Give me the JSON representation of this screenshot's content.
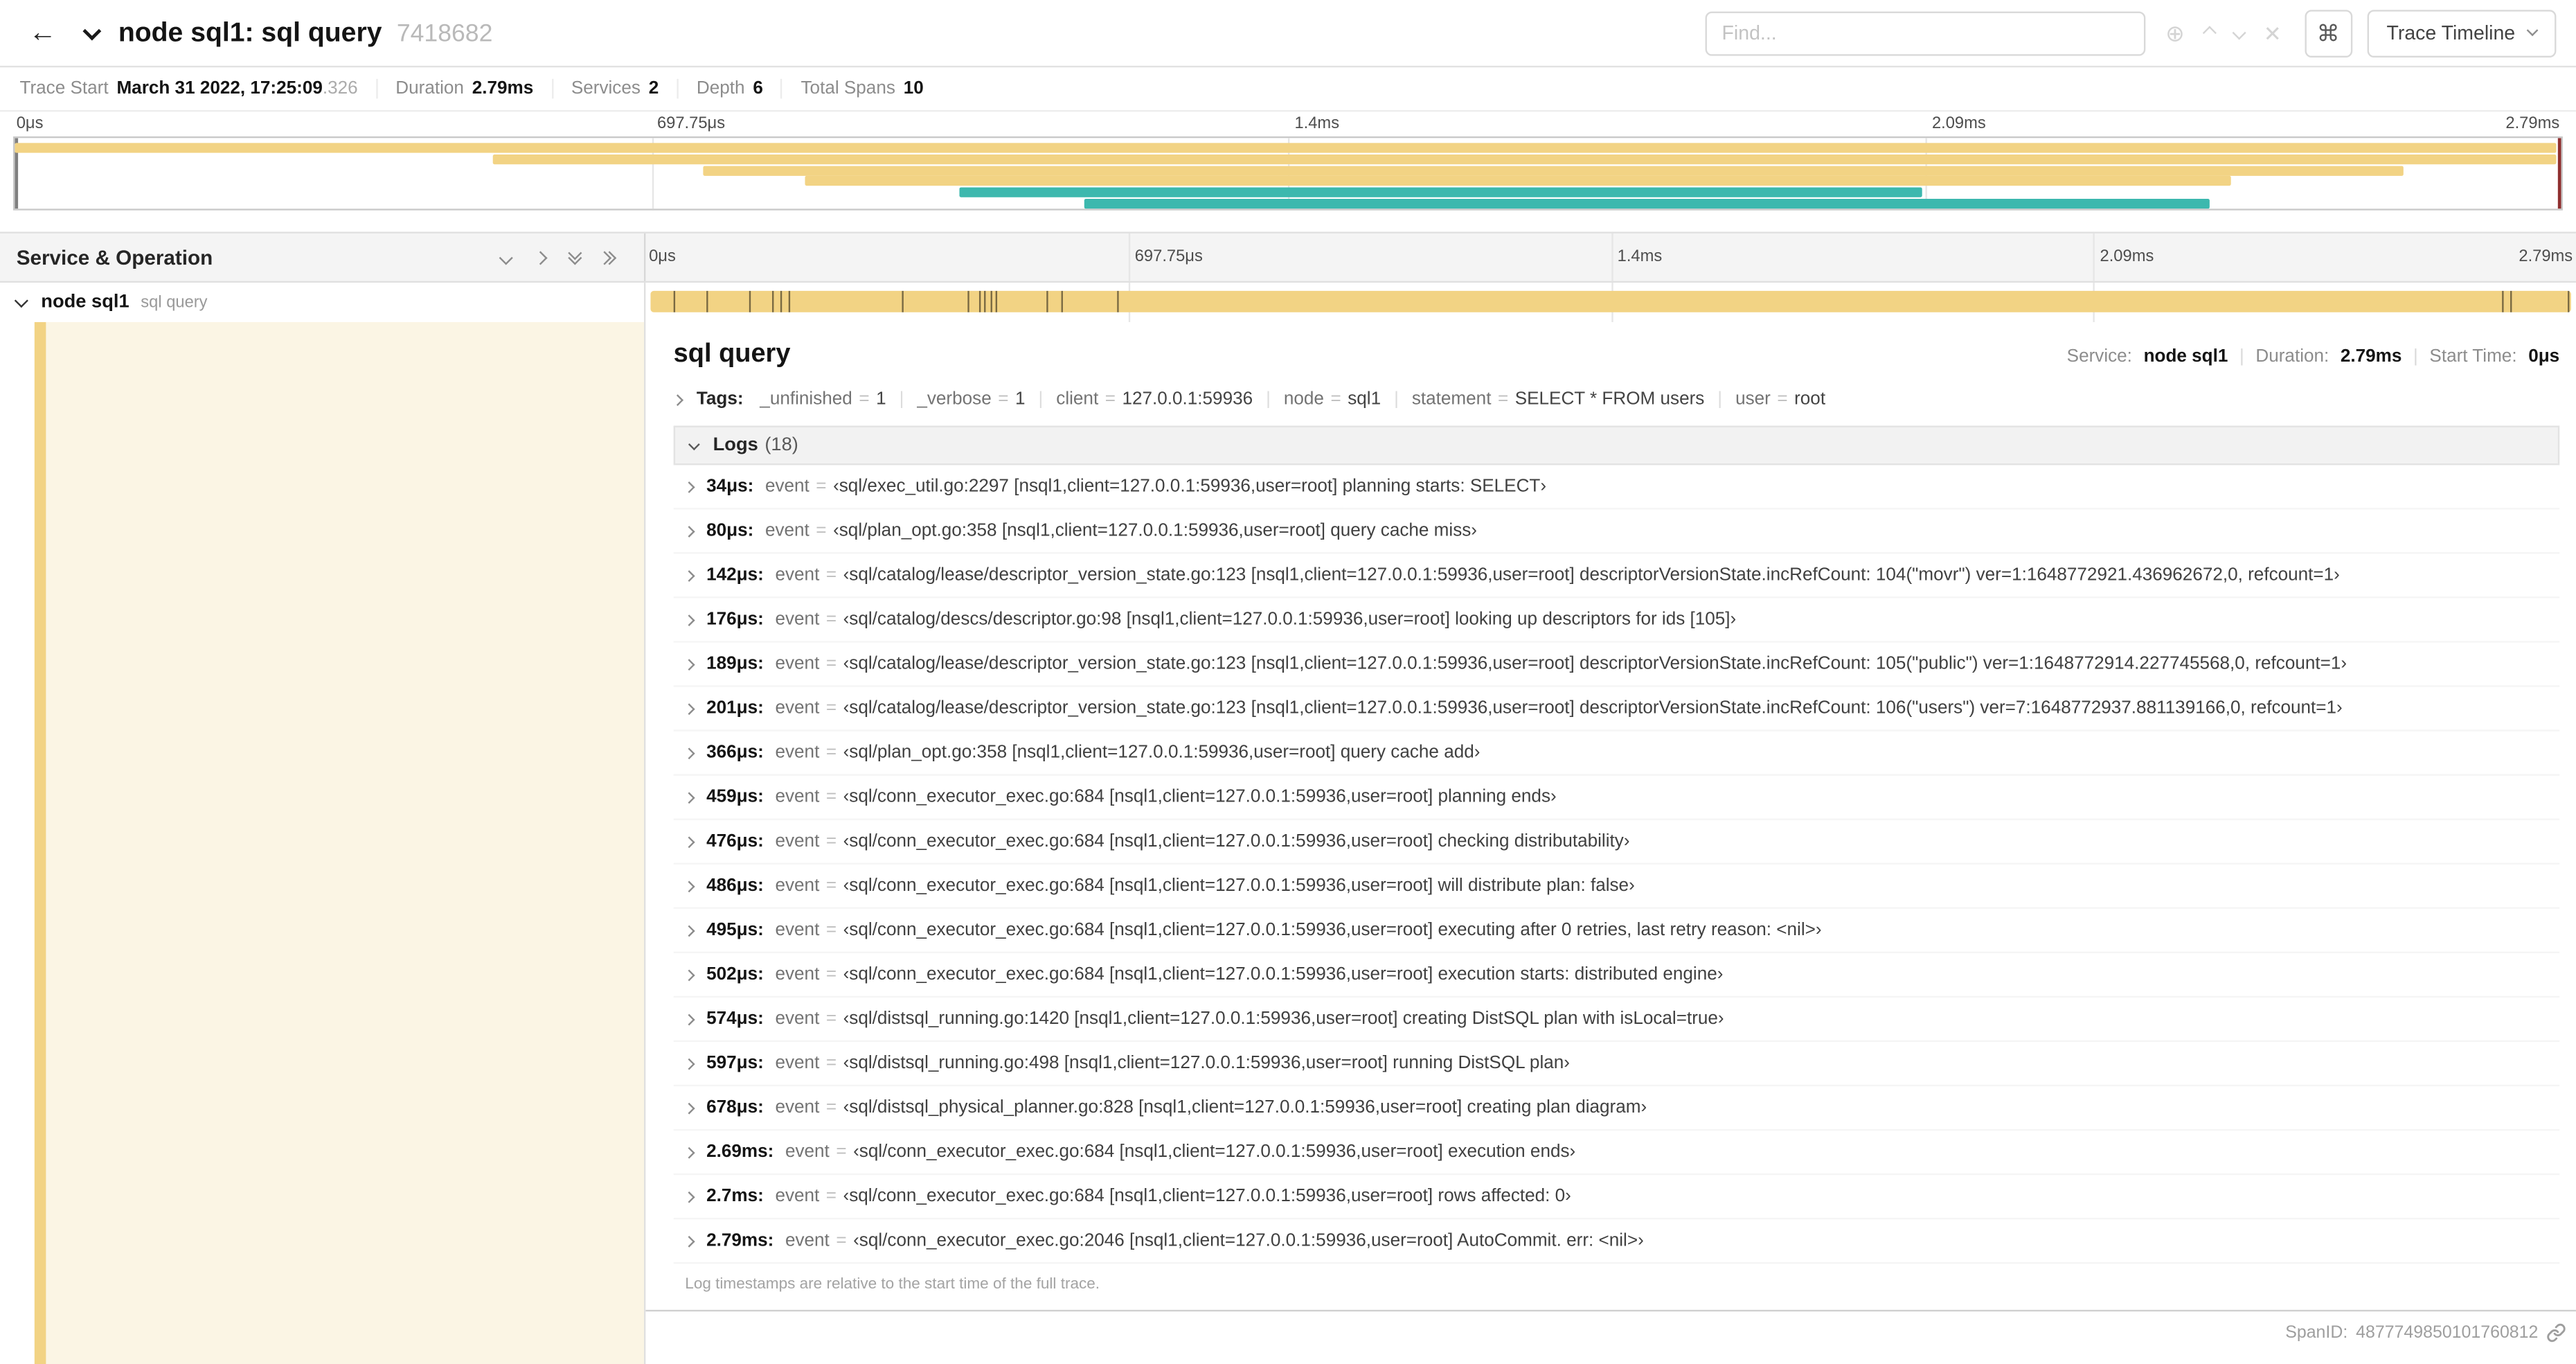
{
  "header": {
    "title": "node sql1: sql query",
    "trace_id": "7418682",
    "find_placeholder": "Find...",
    "shortcut": "⌘",
    "view_button": "Trace Timeline"
  },
  "summary": [
    {
      "label": "Trace Start",
      "value": "March 31 2022, 17:25:09",
      "muted": ".326"
    },
    {
      "label": "Duration",
      "value": "2.79ms",
      "muted": ""
    },
    {
      "label": "Services",
      "value": "2",
      "muted": ""
    },
    {
      "label": "Depth",
      "value": "6",
      "muted": ""
    },
    {
      "label": "Total Spans",
      "value": "10",
      "muted": ""
    }
  ],
  "ticks": [
    "0μs",
    "697.75μs",
    "1.4ms",
    "2.09ms",
    "2.79ms"
  ],
  "colors": {
    "span_tan": "#F2D384",
    "span_teal": "#3CB8AE"
  },
  "minimap_spans": [
    {
      "row": 0,
      "left": 0,
      "width": 99.8,
      "color": "#F2D384"
    },
    {
      "row": 1,
      "left": 18.8,
      "width": 81.0,
      "color": "#F2D384"
    },
    {
      "row": 2,
      "left": 27.0,
      "width": 66.8,
      "color": "#F2D384"
    },
    {
      "row": 3,
      "left": 31.0,
      "width": 56.0,
      "color": "#F2D384"
    },
    {
      "row": 4,
      "left": 37.1,
      "width": 37.8,
      "color": "#3CB8AE"
    },
    {
      "row": 5,
      "left": 42.0,
      "width": 44.2,
      "color": "#3CB8AE"
    }
  ],
  "row_ticks": [
    1.2,
    2.9,
    5.1,
    6.3,
    6.8,
    7.2,
    13.1,
    16.5,
    17.1,
    17.4,
    17.7,
    18.0,
    20.6,
    21.4,
    24.3,
    96.4,
    96.8,
    99.8
  ],
  "timeline": {
    "left_title": "Service & Operation",
    "row": {
      "service": "node sql1",
      "operation": "sql query"
    }
  },
  "detail": {
    "title": "sql query",
    "overview": [
      {
        "label": "Service:",
        "value": "node sql1"
      },
      {
        "label": "Duration:",
        "value": "2.79ms"
      },
      {
        "label": "Start Time:",
        "value": "0μs"
      }
    ],
    "tags_label": "Tags:",
    "tags": [
      {
        "key": "_unfinished",
        "value": "1"
      },
      {
        "key": "_verbose",
        "value": "1"
      },
      {
        "key": "client",
        "value": "127.0.0.1:59936"
      },
      {
        "key": "node",
        "value": "sql1"
      },
      {
        "key": "statement",
        "value": "SELECT * FROM users"
      },
      {
        "key": "user",
        "value": "root"
      }
    ],
    "logs_title": "Logs",
    "logs_count": "(18)",
    "logs": [
      {
        "time": "34μs:",
        "key": "event",
        "value": "‹sql/exec_util.go:2297 [nsql1,client=127.0.0.1:59936,user=root] planning starts: SELECT›"
      },
      {
        "time": "80μs:",
        "key": "event",
        "value": "‹sql/plan_opt.go:358 [nsql1,client=127.0.0.1:59936,user=root] query cache miss›"
      },
      {
        "time": "142μs:",
        "key": "event",
        "value": "‹sql/catalog/lease/descriptor_version_state.go:123 [nsql1,client=127.0.0.1:59936,user=root] descriptorVersionState.incRefCount: 104(\"movr\") ver=1:1648772921.436962672,0, refcount=1›"
      },
      {
        "time": "176μs:",
        "key": "event",
        "value": "‹sql/catalog/descs/descriptor.go:98 [nsql1,client=127.0.0.1:59936,user=root] looking up descriptors for ids [105]›"
      },
      {
        "time": "189μs:",
        "key": "event",
        "value": "‹sql/catalog/lease/descriptor_version_state.go:123 [nsql1,client=127.0.0.1:59936,user=root] descriptorVersionState.incRefCount: 105(\"public\") ver=1:1648772914.227745568,0, refcount=1›"
      },
      {
        "time": "201μs:",
        "key": "event",
        "value": "‹sql/catalog/lease/descriptor_version_state.go:123 [nsql1,client=127.0.0.1:59936,user=root] descriptorVersionState.incRefCount: 106(\"users\") ver=7:1648772937.881139166,0, refcount=1›"
      },
      {
        "time": "366μs:",
        "key": "event",
        "value": "‹sql/plan_opt.go:358 [nsql1,client=127.0.0.1:59936,user=root] query cache add›"
      },
      {
        "time": "459μs:",
        "key": "event",
        "value": "‹sql/conn_executor_exec.go:684 [nsql1,client=127.0.0.1:59936,user=root] planning ends›"
      },
      {
        "time": "476μs:",
        "key": "event",
        "value": "‹sql/conn_executor_exec.go:684 [nsql1,client=127.0.0.1:59936,user=root] checking distributability›"
      },
      {
        "time": "486μs:",
        "key": "event",
        "value": "‹sql/conn_executor_exec.go:684 [nsql1,client=127.0.0.1:59936,user=root] will distribute plan: false›"
      },
      {
        "time": "495μs:",
        "key": "event",
        "value": "‹sql/conn_executor_exec.go:684 [nsql1,client=127.0.0.1:59936,user=root] executing after 0 retries, last retry reason: <nil>›"
      },
      {
        "time": "502μs:",
        "key": "event",
        "value": "‹sql/conn_executor_exec.go:684 [nsql1,client=127.0.0.1:59936,user=root] execution starts: distributed engine›"
      },
      {
        "time": "574μs:",
        "key": "event",
        "value": "‹sql/distsql_running.go:1420 [nsql1,client=127.0.0.1:59936,user=root] creating DistSQL plan with isLocal=true›"
      },
      {
        "time": "597μs:",
        "key": "event",
        "value": "‹sql/distsql_running.go:498 [nsql1,client=127.0.0.1:59936,user=root] running DistSQL plan›"
      },
      {
        "time": "678μs:",
        "key": "event",
        "value": "‹sql/distsql_physical_planner.go:828 [nsql1,client=127.0.0.1:59936,user=root] creating plan diagram›"
      },
      {
        "time": "2.69ms:",
        "key": "event",
        "value": "‹sql/conn_executor_exec.go:684 [nsql1,client=127.0.0.1:59936,user=root] execution ends›"
      },
      {
        "time": "2.7ms:",
        "key": "event",
        "value": "‹sql/conn_executor_exec.go:684 [nsql1,client=127.0.0.1:59936,user=root] rows affected: 0›"
      },
      {
        "time": "2.79ms:",
        "key": "event",
        "value": "‹sql/conn_executor_exec.go:2046 [nsql1,client=127.0.0.1:59936,user=root] AutoCommit. err: <nil>›"
      }
    ],
    "note": "Log timestamps are relative to the start time of the full trace.",
    "span_id_label": "SpanID:",
    "span_id": "4877749850101760812"
  }
}
